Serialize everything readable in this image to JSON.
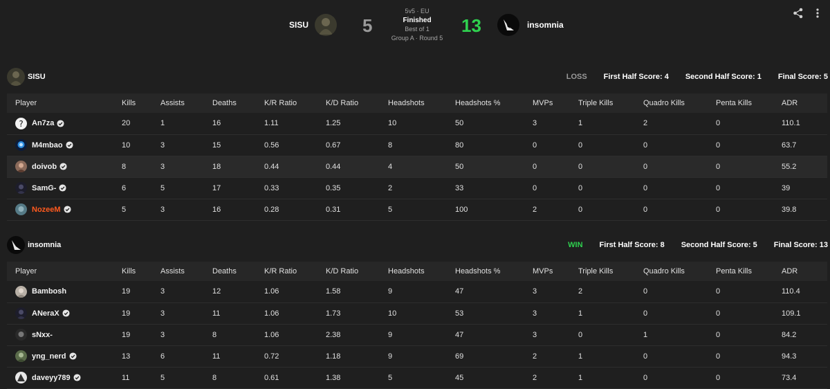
{
  "match": {
    "format": "5v5 · EU",
    "status": "Finished",
    "best_of": "Best of 1",
    "round_info": "Group A · Round 5",
    "team1": {
      "name": "SISU",
      "score": "5"
    },
    "team2": {
      "name": "insomnia",
      "score": "13"
    }
  },
  "columns": [
    "Player",
    "Kills",
    "Assists",
    "Deaths",
    "K/R Ratio",
    "K/D Ratio",
    "Headshots",
    "Headshots %",
    "MVPs",
    "Triple Kills",
    "Quadro Kills",
    "Penta Kills",
    "ADR"
  ],
  "teams": [
    {
      "name": "SISU",
      "result": "LOSS",
      "first_half": "First Half Score: 4",
      "second_half": "Second Half Score: 1",
      "final": "Final Score: 5",
      "players": [
        {
          "name": "An7za",
          "verified": true,
          "avatar": "question-avatar",
          "stats": [
            "20",
            "1",
            "16",
            "1.11",
            "1.25",
            "10",
            "50",
            "3",
            "1",
            "2",
            "0",
            "110.1"
          ]
        },
        {
          "name": "M4mbao",
          "verified": true,
          "avatar": "blue-avatar",
          "stats": [
            "10",
            "3",
            "15",
            "0.56",
            "0.67",
            "8",
            "80",
            "0",
            "0",
            "0",
            "0",
            "63.7"
          ]
        },
        {
          "name": "doivob",
          "verified": true,
          "avatar": "photo-avatar",
          "stats": [
            "8",
            "3",
            "18",
            "0.44",
            "0.44",
            "4",
            "50",
            "0",
            "0",
            "0",
            "0",
            "55.2"
          ]
        },
        {
          "name": "SamG-",
          "verified": true,
          "avatar": "dark-avatar",
          "stats": [
            "6",
            "5",
            "17",
            "0.33",
            "0.35",
            "2",
            "33",
            "0",
            "0",
            "0",
            "0",
            "39"
          ]
        },
        {
          "name": "NozeeM",
          "verified": true,
          "avatar": "teal-avatar",
          "orange": true,
          "stats": [
            "5",
            "3",
            "16",
            "0.28",
            "0.31",
            "5",
            "100",
            "2",
            "0",
            "0",
            "0",
            "39.8"
          ]
        }
      ]
    },
    {
      "name": "insomnia",
      "result": "WIN",
      "first_half": "First Half Score: 8",
      "second_half": "Second Half Score: 5",
      "final": "Final Score: 13",
      "players": [
        {
          "name": "Bambosh",
          "verified": false,
          "avatar": "light-avatar",
          "stats": [
            "19",
            "3",
            "12",
            "1.06",
            "1.58",
            "9",
            "47",
            "3",
            "2",
            "0",
            "0",
            "110.4"
          ]
        },
        {
          "name": "ANeraX",
          "verified": true,
          "avatar": "dark-avatar",
          "stats": [
            "19",
            "3",
            "11",
            "1.06",
            "1.73",
            "10",
            "53",
            "3",
            "1",
            "0",
            "0",
            "109.1"
          ]
        },
        {
          "name": "sNxx-",
          "verified": false,
          "avatar": "gray-avatar",
          "stats": [
            "19",
            "3",
            "8",
            "1.06",
            "2.38",
            "9",
            "47",
            "3",
            "0",
            "1",
            "0",
            "84.2"
          ]
        },
        {
          "name": "yng_nerd",
          "verified": true,
          "avatar": "green-avatar",
          "stats": [
            "13",
            "6",
            "11",
            "0.72",
            "1.18",
            "9",
            "69",
            "2",
            "1",
            "0",
            "0",
            "94.3"
          ]
        },
        {
          "name": "daveyy789",
          "verified": true,
          "avatar": "white-avatar",
          "stats": [
            "11",
            "5",
            "8",
            "0.61",
            "1.38",
            "5",
            "45",
            "2",
            "1",
            "0",
            "0",
            "73.4"
          ]
        }
      ]
    }
  ],
  "colors": {
    "background": "#1f1f1f",
    "win": "#2fd14f",
    "loss": "#9a9a9a",
    "highlight_name": "#ff5a1f"
  },
  "icons": {
    "share": "share-icon",
    "more": "more-vertical-icon"
  }
}
